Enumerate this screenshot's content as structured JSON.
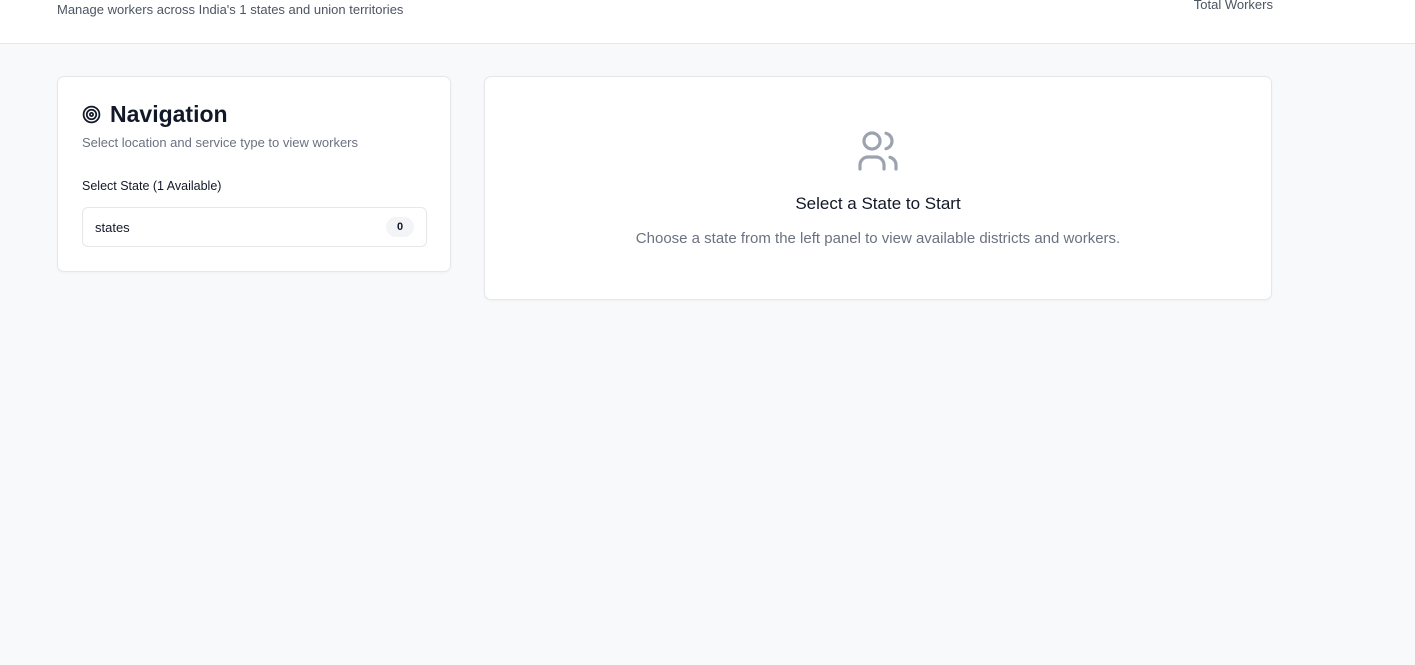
{
  "header": {
    "subtitle": "Manage workers across India's 1 states and union territories",
    "stat_label": "Total Workers"
  },
  "navigation": {
    "title": "Navigation",
    "icon": "target-icon",
    "description": "Select location and service type to view workers",
    "state_field_label": "Select State (1 Available)",
    "states": [
      {
        "name": "states",
        "count": "0"
      }
    ]
  },
  "empty_state": {
    "icon": "users-icon",
    "title": "Select a State to Start",
    "description": "Choose a state from the left panel to view available districts and workers."
  },
  "colors": {
    "background": "#f8f9fb",
    "card": "#ffffff",
    "border": "#e5e7eb",
    "muted_text": "#6b7280",
    "icon_gray": "#9ca3af"
  }
}
